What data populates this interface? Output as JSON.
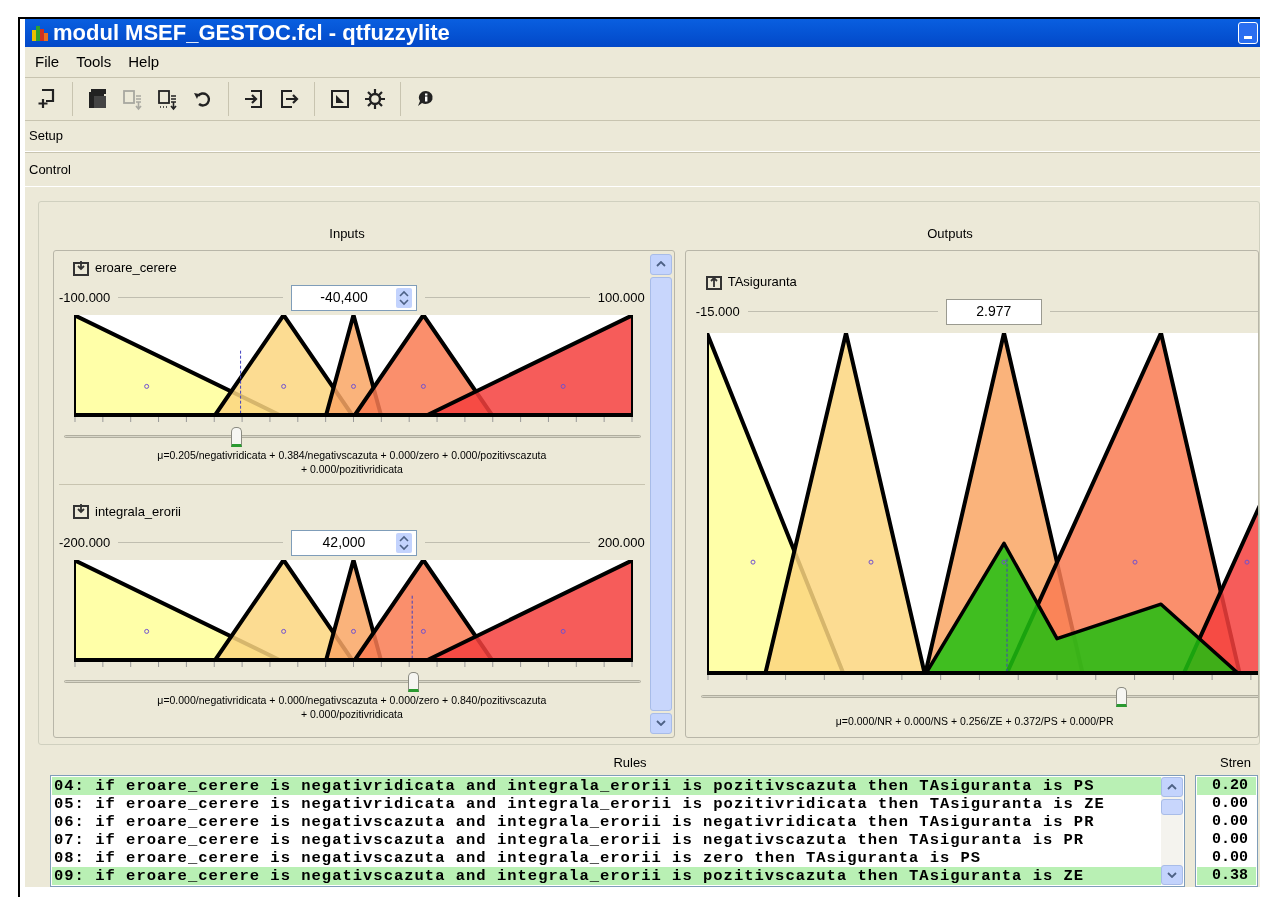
{
  "window": {
    "title": "modul MSEF_GESTOC.fcl - qtfuzzylite"
  },
  "menu": [
    "File",
    "Tools",
    "Help"
  ],
  "toolbar": [
    {
      "kind": "add",
      "disabled": false
    },
    {
      "kind": "open",
      "disabled": false
    },
    {
      "kind": "export",
      "disabled": true
    },
    {
      "kind": "exportmore",
      "disabled": false
    },
    {
      "kind": "undo",
      "disabled": false
    },
    {
      "kind": "import",
      "disabled": false
    },
    {
      "kind": "output",
      "disabled": false
    },
    {
      "kind": "chart",
      "disabled": false
    },
    {
      "kind": "gear",
      "disabled": false
    },
    {
      "kind": "info",
      "disabled": false
    }
  ],
  "sections": [
    "Setup",
    "Control"
  ],
  "inputs_title": "Inputs",
  "outputs_title": "Outputs",
  "inputs": [
    {
      "name": "eroare_cerere",
      "min": "-100.000",
      "max": "100.000",
      "value": "-40,400",
      "level": 0.298,
      "memberships": "μ=0.205/negativridicata + 0.384/negativscazuta + 0.000/zero + 0.000/pozitivscazuta + 0.000/pozitivridicata"
    },
    {
      "name": "integrala_erorii",
      "min": "-200.000",
      "max": "200.000",
      "value": "42,000",
      "level": 0.605,
      "memberships": "μ=0.000/negativridicata + 0.000/negativscazuta + 0.000/zero + 0.840/pozitivscazuta + 0.000/pozitivridicata"
    }
  ],
  "output": {
    "name": "TAsiguranta",
    "min": "-15.000",
    "value": "2.977",
    "level": 0.6,
    "memberships": "μ=0.000/NR + 0.000/NS + 0.256/ZE + 0.372/PS + 0.000/PR"
  },
  "rules": {
    "title": "Rules",
    "strength_title": "Stren",
    "rows": [
      {
        "text": "04: if eroare_cerere is negativridicata and integrala_erorii is pozitivscazuta then TAsiguranta is PS",
        "strength": "0.20",
        "selected": true
      },
      {
        "text": "05: if eroare_cerere is negativridicata and integrala_erorii is pozitivridicata then TAsiguranta is ZE",
        "strength": "0.00",
        "selected": false
      },
      {
        "text": "06: if eroare_cerere is negativscazuta and integrala_erorii is negativridicata then TAsiguranta is PR",
        "strength": "0.00",
        "selected": false
      },
      {
        "text": "07: if eroare_cerere is negativscazuta and integrala_erorii is negativscazuta then TAsiguranta is PR",
        "strength": "0.00",
        "selected": false
      },
      {
        "text": "08: if eroare_cerere is negativscazuta and integrala_erorii is zero then TAsiguranta is PS",
        "strength": "0.00",
        "selected": false
      },
      {
        "text": "09: if eroare_cerere is negativscazuta and integrala_erorii is pozitivscazuta then TAsiguranta is ZE",
        "strength": "0.38",
        "selected": true
      }
    ]
  }
}
